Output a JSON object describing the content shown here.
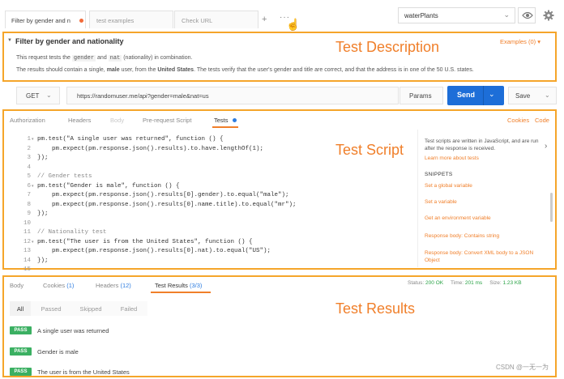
{
  "top_tabs": {
    "active_label": "Filter by gender and n",
    "tab1_placeholder": "test examples",
    "tab2_placeholder": "Check URL",
    "add_label": "+",
    "more_label": "···"
  },
  "environment": {
    "selected": "waterPlants"
  },
  "description": {
    "title": "Filter by gender and nationality",
    "line1_a": "This request tests the ",
    "line1_code1": "gender",
    "line1_b": " and ",
    "line1_code2": "nat",
    "line1_c": " (nationality) in combination.",
    "line2_a": "The results should contain a single, ",
    "line2_b1": "male",
    "line2_c": " user, from the ",
    "line2_b2": "United States",
    "line2_d": ". The tests verify that the user's gender and title are correct, and that the address is in one of the 50 U.S. states.",
    "examples": "Examples (0)",
    "examples_chevron": "▾"
  },
  "annotations": {
    "description": "Test Description",
    "script": "Test Script",
    "results": "Test Results"
  },
  "request": {
    "method": "GET",
    "url": "https://randomuser.me/api?gender=male&nat=us",
    "params": "Params",
    "send": "Send",
    "save": "Save"
  },
  "request_tabs": [
    "Authorization",
    "Headers",
    "Body",
    "Pre-request Script",
    "Tests"
  ],
  "request_links": {
    "cookies": "Cookies",
    "code": "Code"
  },
  "editor": {
    "line_numbers": [
      "1",
      "2",
      "3",
      "4",
      "5",
      "6",
      "7",
      "8",
      "9",
      "10",
      "11",
      "12",
      "13",
      "14",
      "15"
    ],
    "fold_markers": [
      "1",
      "6",
      "12"
    ],
    "lines": [
      "pm.test(\"A single user was returned\", function () {",
      "    pm.expect(pm.response.json().results).to.have.lengthOf(1);",
      "});",
      "",
      "// Gender tests",
      "pm.test(\"Gender is male\", function () {",
      "    pm.expect(pm.response.json().results[0].gender).to.equal(\"male\");",
      "    pm.expect(pm.response.json().results[0].name.title).to.equal(\"mr\");",
      "});",
      "",
      "// Nationality test",
      "pm.test(\"The user is from the United States\", function () {",
      "    pm.expect(pm.response.json().results[0].nat).to.equal(\"US\");",
      "});",
      ""
    ]
  },
  "snippets": {
    "intro": "Test scripts are written in JavaScript, and are run after the response is received.",
    "learn_more": "Learn more about tests",
    "heading": "SNIPPETS",
    "items": [
      "Set a global variable",
      "Set a variable",
      "Get an environment variable",
      "Response body: Contains string",
      "Response body: Convert XML body to a JSON",
      "Object"
    ]
  },
  "response_tabs": {
    "body": "Body",
    "cookies": "Cookies",
    "cookies_count": "(1)",
    "headers": "Headers",
    "headers_count": "(12)",
    "test_results": "Test Results",
    "test_results_count": "(3/3)"
  },
  "status": {
    "status_label": "Status:",
    "status_value": "200 OK",
    "time_label": "Time:",
    "time_value": "201 ms",
    "size_label": "Size:",
    "size_value": "1.23 KB"
  },
  "filters": [
    "All",
    "Passed",
    "Skipped",
    "Failed"
  ],
  "results": [
    {
      "badge": "PASS",
      "name": "A single user was returned"
    },
    {
      "badge": "PASS",
      "name": "Gender is male"
    },
    {
      "badge": "PASS",
      "name": "The user is from the United States"
    }
  ],
  "watermark": "CSDN @一无一为",
  "colors": {
    "accent": "#f07f2a",
    "send_button": "#1d6ed8",
    "pass_badge": "#3bb062",
    "annotation_border": "#f5a52a"
  }
}
